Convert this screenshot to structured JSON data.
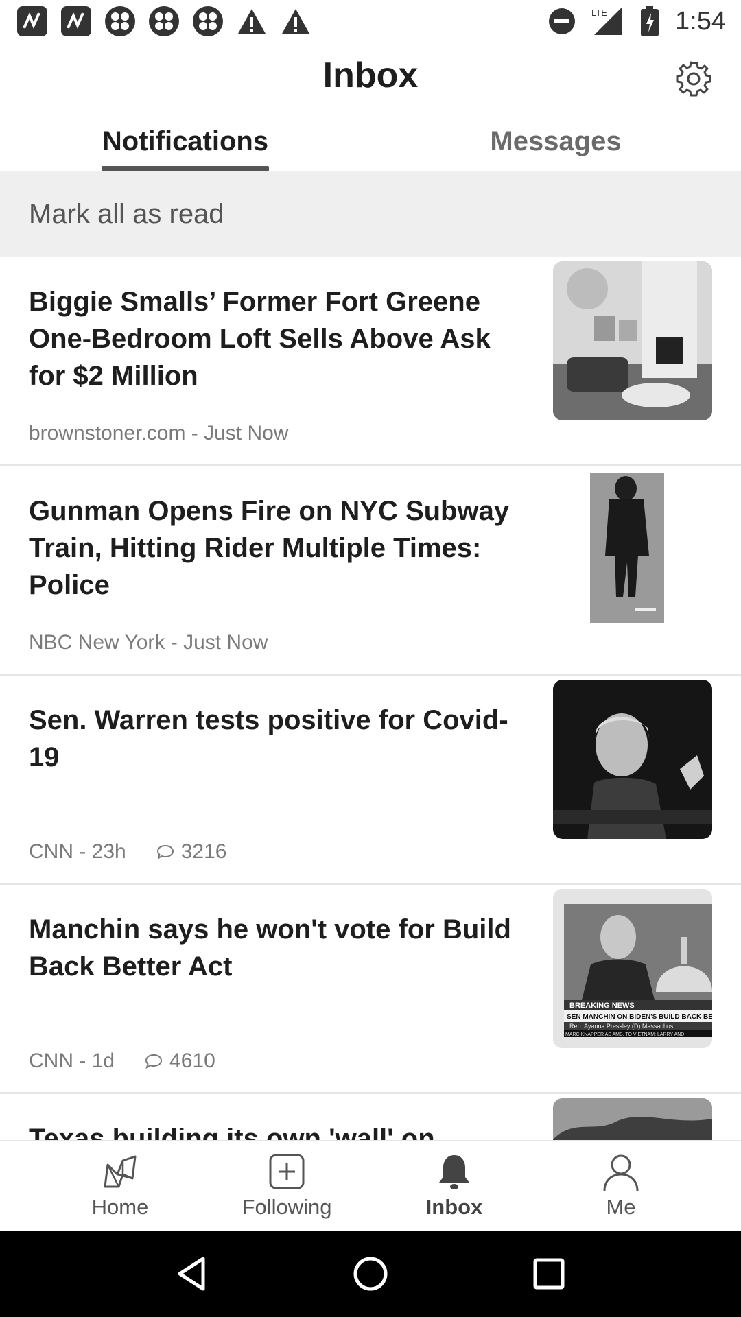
{
  "status_bar": {
    "time": "1:54",
    "network": "LTE",
    "notification_icons": [
      "app-icon",
      "app-icon",
      "clover-icon",
      "clover-icon",
      "clover-icon",
      "warning-icon",
      "warning-icon"
    ]
  },
  "header": {
    "title": "Inbox"
  },
  "tabs": [
    {
      "label": "Notifications",
      "active": true
    },
    {
      "label": "Messages",
      "active": false
    }
  ],
  "mark_all_label": "Mark all as read",
  "feed": [
    {
      "title": "Biggie Smalls’ Former Fort Greene One-Bedroom Loft Sells Above Ask for $2 Million",
      "source": "brownstoner.com - Just Now",
      "comments": null
    },
    {
      "title": "Gunman Opens Fire on NYC Subway Train, Hitting Rider Multiple Times: Police",
      "source": "NBC New York - Just Now",
      "comments": null
    },
    {
      "title": "Sen. Warren tests positive for Covid-19",
      "source": "CNN - 23h",
      "comments": "3216"
    },
    {
      "title": "Manchin says he won't vote for Build Back Better Act",
      "source": "CNN - 1d",
      "comments": "4610",
      "thumb_caption": "BREAKING NEWS",
      "thumb_chyron": "SEN MANCHIN ON BIDEN'S BUILD BACK BET",
      "thumb_subline": "Rep. Ayanna Pressley   (D) Massachus",
      "thumb_ticker": "MARC KNAPPER AS AMB. TO VIETNAM; LARRY AND"
    },
    {
      "title": "Texas building its own 'wall' on Mexico",
      "source": "",
      "comments": null
    }
  ],
  "bottom_nav": [
    {
      "label": "Home",
      "icon": "home-icon",
      "active": false
    },
    {
      "label": "Following",
      "icon": "plus-square-icon",
      "active": false
    },
    {
      "label": "Inbox",
      "icon": "bell-icon",
      "active": true
    },
    {
      "label": "Me",
      "icon": "person-icon",
      "active": false
    }
  ],
  "colors": {
    "accent_underline": "#555555",
    "mark_bar_bg": "#efefef",
    "system_nav_bg": "#000000"
  }
}
